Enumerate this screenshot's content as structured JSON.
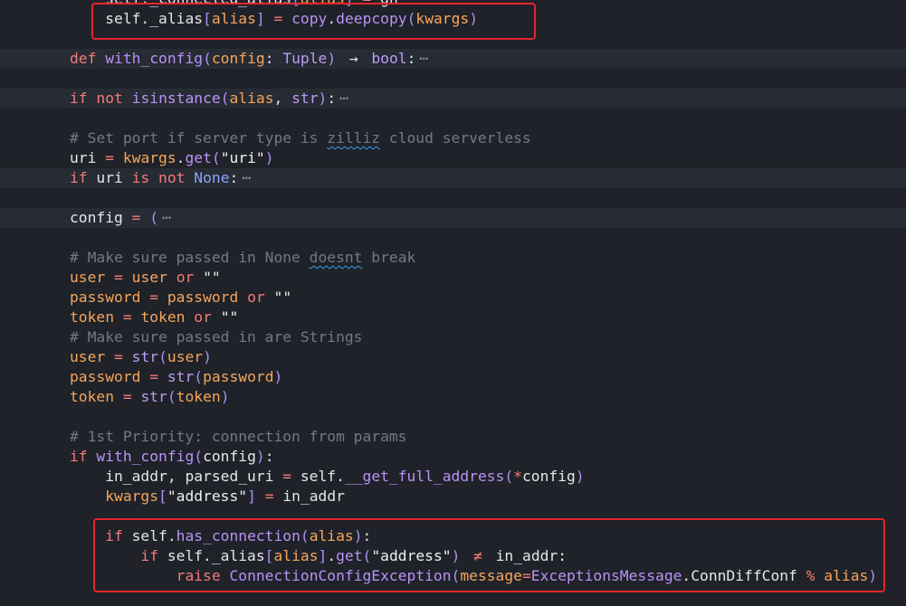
{
  "colors": {
    "background": "#1f2228",
    "fold-band": "#272b33",
    "keyword": "#f47a7a",
    "function": "#b992f8",
    "type": "#bd9cf7",
    "parameter": "#f5a55e",
    "identifier": "#e4e6ea",
    "string": "#eef0f3",
    "constant": "#8ea4ff",
    "bracket": "#ab8ff2",
    "comment": "#737985",
    "fold-marker": "#8c919b",
    "spellcheck": "#3d9df5",
    "annotation": "#e3252b"
  },
  "editor": {
    "lines": [
      {
        "tokens": [
          {
            "t": "    ",
            "k": "ws"
          },
          {
            "t": "self._connected_alias",
            "k": "plain"
          },
          {
            "t": "[",
            "k": "br"
          },
          {
            "t": "alias",
            "k": "param"
          },
          {
            "t": "]",
            "k": "br"
          },
          {
            "t": " ",
            "k": "plain"
          },
          {
            "t": "=",
            "k": "op"
          },
          {
            "t": " gh",
            "k": "plain"
          }
        ]
      },
      {
        "tokens": [
          {
            "t": "    ",
            "k": "ws"
          },
          {
            "t": "self._alias",
            "k": "plain"
          },
          {
            "t": "[",
            "k": "br"
          },
          {
            "t": "alias",
            "k": "param"
          },
          {
            "t": "]",
            "k": "br"
          },
          {
            "t": " ",
            "k": "plain"
          },
          {
            "t": "=",
            "k": "op"
          },
          {
            "t": " ",
            "k": "plain"
          },
          {
            "t": "copy",
            "k": "fn"
          },
          {
            "t": ".",
            "k": "plain"
          },
          {
            "t": "deepcopy",
            "k": "fn"
          },
          {
            "t": "(",
            "k": "br"
          },
          {
            "t": "kwargs",
            "k": "param"
          },
          {
            "t": ")",
            "k": "br"
          }
        ]
      },
      {
        "tokens": []
      },
      {
        "folded": true,
        "tokens": [
          {
            "t": "def",
            "k": "kw"
          },
          {
            "t": " ",
            "k": "plain"
          },
          {
            "t": "with_config",
            "k": "fn"
          },
          {
            "t": "(",
            "k": "br"
          },
          {
            "t": "config",
            "k": "param"
          },
          {
            "t": ": ",
            "k": "plain"
          },
          {
            "t": "Tuple",
            "k": "type"
          },
          {
            "t": ")",
            "k": "br"
          },
          {
            "t": " ",
            "k": "plain"
          },
          {
            "t": "→",
            "k": "plain"
          },
          {
            "t": " ",
            "k": "plain"
          },
          {
            "t": "bool",
            "k": "type"
          },
          {
            "t": ":",
            "k": "plain"
          },
          {
            "t": "⋯",
            "k": "fold"
          }
        ]
      },
      {
        "tokens": []
      },
      {
        "folded": true,
        "tokens": [
          {
            "t": "if",
            "k": "kw"
          },
          {
            "t": " ",
            "k": "plain"
          },
          {
            "t": "not",
            "k": "kw"
          },
          {
            "t": " ",
            "k": "plain"
          },
          {
            "t": "isinstance",
            "k": "fn"
          },
          {
            "t": "(",
            "k": "br"
          },
          {
            "t": "alias",
            "k": "param"
          },
          {
            "t": ", ",
            "k": "plain"
          },
          {
            "t": "str",
            "k": "type"
          },
          {
            "t": ")",
            "k": "br"
          },
          {
            "t": ":",
            "k": "plain"
          },
          {
            "t": "⋯",
            "k": "fold"
          }
        ]
      },
      {
        "tokens": []
      },
      {
        "tokens": [
          {
            "t": "# Set port if server type is ",
            "k": "comment"
          },
          {
            "t": "zilliz",
            "k": "comment",
            "spell": true
          },
          {
            "t": " cloud serverless",
            "k": "comment"
          }
        ]
      },
      {
        "tokens": [
          {
            "t": "uri ",
            "k": "plain"
          },
          {
            "t": "=",
            "k": "op"
          },
          {
            "t": " ",
            "k": "plain"
          },
          {
            "t": "kwargs",
            "k": "param"
          },
          {
            "t": ".",
            "k": "plain"
          },
          {
            "t": "get",
            "k": "fn"
          },
          {
            "t": "(",
            "k": "br"
          },
          {
            "t": "\"uri\"",
            "k": "str"
          },
          {
            "t": ")",
            "k": "br"
          }
        ]
      },
      {
        "folded": true,
        "tokens": [
          {
            "t": "if",
            "k": "kw"
          },
          {
            "t": " uri ",
            "k": "plain"
          },
          {
            "t": "is",
            "k": "kw"
          },
          {
            "t": " ",
            "k": "plain"
          },
          {
            "t": "not",
            "k": "kw"
          },
          {
            "t": " ",
            "k": "plain"
          },
          {
            "t": "None",
            "k": "const"
          },
          {
            "t": ":",
            "k": "plain"
          },
          {
            "t": "⋯",
            "k": "fold"
          }
        ]
      },
      {
        "tokens": []
      },
      {
        "folded": true,
        "tokens": [
          {
            "t": "config ",
            "k": "plain"
          },
          {
            "t": "=",
            "k": "op"
          },
          {
            "t": " ",
            "k": "plain"
          },
          {
            "t": "(",
            "k": "br"
          },
          {
            "t": "⋯",
            "k": "fold"
          }
        ]
      },
      {
        "tokens": []
      },
      {
        "tokens": [
          {
            "t": "# Make sure passed in None ",
            "k": "comment"
          },
          {
            "t": "doesnt",
            "k": "comment",
            "spell": true
          },
          {
            "t": " break",
            "k": "comment"
          }
        ]
      },
      {
        "tokens": [
          {
            "t": "user",
            "k": "param"
          },
          {
            "t": " ",
            "k": "plain"
          },
          {
            "t": "=",
            "k": "op"
          },
          {
            "t": " ",
            "k": "plain"
          },
          {
            "t": "user",
            "k": "param"
          },
          {
            "t": " ",
            "k": "plain"
          },
          {
            "t": "or",
            "k": "kw"
          },
          {
            "t": " ",
            "k": "plain"
          },
          {
            "t": "\"\"",
            "k": "str"
          }
        ]
      },
      {
        "tokens": [
          {
            "t": "password",
            "k": "param"
          },
          {
            "t": " ",
            "k": "plain"
          },
          {
            "t": "=",
            "k": "op"
          },
          {
            "t": " ",
            "k": "plain"
          },
          {
            "t": "password",
            "k": "param"
          },
          {
            "t": " ",
            "k": "plain"
          },
          {
            "t": "or",
            "k": "kw"
          },
          {
            "t": " ",
            "k": "plain"
          },
          {
            "t": "\"\"",
            "k": "str"
          }
        ]
      },
      {
        "tokens": [
          {
            "t": "token",
            "k": "param"
          },
          {
            "t": " ",
            "k": "plain"
          },
          {
            "t": "=",
            "k": "op"
          },
          {
            "t": " ",
            "k": "plain"
          },
          {
            "t": "token",
            "k": "param"
          },
          {
            "t": " ",
            "k": "plain"
          },
          {
            "t": "or",
            "k": "kw"
          },
          {
            "t": " ",
            "k": "plain"
          },
          {
            "t": "\"\"",
            "k": "str"
          }
        ]
      },
      {
        "tokens": [
          {
            "t": "# Make sure passed in are Strings",
            "k": "comment"
          }
        ]
      },
      {
        "tokens": [
          {
            "t": "user",
            "k": "param"
          },
          {
            "t": " ",
            "k": "plain"
          },
          {
            "t": "=",
            "k": "op"
          },
          {
            "t": " ",
            "k": "plain"
          },
          {
            "t": "str",
            "k": "type"
          },
          {
            "t": "(",
            "k": "br"
          },
          {
            "t": "user",
            "k": "param"
          },
          {
            "t": ")",
            "k": "br"
          }
        ]
      },
      {
        "tokens": [
          {
            "t": "password",
            "k": "param"
          },
          {
            "t": " ",
            "k": "plain"
          },
          {
            "t": "=",
            "k": "op"
          },
          {
            "t": " ",
            "k": "plain"
          },
          {
            "t": "str",
            "k": "type"
          },
          {
            "t": "(",
            "k": "br"
          },
          {
            "t": "password",
            "k": "param"
          },
          {
            "t": ")",
            "k": "br"
          }
        ]
      },
      {
        "tokens": [
          {
            "t": "token",
            "k": "param"
          },
          {
            "t": " ",
            "k": "plain"
          },
          {
            "t": "=",
            "k": "op"
          },
          {
            "t": " ",
            "k": "plain"
          },
          {
            "t": "str",
            "k": "type"
          },
          {
            "t": "(",
            "k": "br"
          },
          {
            "t": "token",
            "k": "param"
          },
          {
            "t": ")",
            "k": "br"
          }
        ]
      },
      {
        "tokens": []
      },
      {
        "tokens": [
          {
            "t": "# 1st Priority: connection from params",
            "k": "comment"
          }
        ]
      },
      {
        "tokens": [
          {
            "t": "if",
            "k": "kw"
          },
          {
            "t": " ",
            "k": "plain"
          },
          {
            "t": "with_config",
            "k": "fn"
          },
          {
            "t": "(",
            "k": "br"
          },
          {
            "t": "config",
            "k": "plain"
          },
          {
            "t": ")",
            "k": "br"
          },
          {
            "t": ":",
            "k": "plain"
          }
        ]
      },
      {
        "tokens": [
          {
            "t": "    ",
            "k": "ws"
          },
          {
            "t": "in_addr, parsed_uri ",
            "k": "plain"
          },
          {
            "t": "=",
            "k": "op"
          },
          {
            "t": " self.",
            "k": "plain"
          },
          {
            "t": "__get_full_address",
            "k": "fn"
          },
          {
            "t": "(",
            "k": "br"
          },
          {
            "t": "*",
            "k": "op"
          },
          {
            "t": "config",
            "k": "plain"
          },
          {
            "t": ")",
            "k": "br"
          }
        ]
      },
      {
        "tokens": [
          {
            "t": "    ",
            "k": "ws"
          },
          {
            "t": "kwargs",
            "k": "param"
          },
          {
            "t": "[",
            "k": "br"
          },
          {
            "t": "\"address\"",
            "k": "str"
          },
          {
            "t": "]",
            "k": "br"
          },
          {
            "t": " ",
            "k": "plain"
          },
          {
            "t": "=",
            "k": "op"
          },
          {
            "t": " in_addr",
            "k": "plain"
          }
        ]
      },
      {
        "tokens": []
      },
      {
        "tokens": [
          {
            "t": "    ",
            "k": "ws"
          },
          {
            "t": "if",
            "k": "kw"
          },
          {
            "t": " self.",
            "k": "plain"
          },
          {
            "t": "has_connection",
            "k": "fn"
          },
          {
            "t": "(",
            "k": "br"
          },
          {
            "t": "alias",
            "k": "param"
          },
          {
            "t": ")",
            "k": "br"
          },
          {
            "t": ":",
            "k": "plain"
          }
        ]
      },
      {
        "tokens": [
          {
            "t": "        ",
            "k": "ws"
          },
          {
            "t": "if",
            "k": "kw"
          },
          {
            "t": " self._alias",
            "k": "plain"
          },
          {
            "t": "[",
            "k": "br"
          },
          {
            "t": "alias",
            "k": "param"
          },
          {
            "t": "]",
            "k": "br"
          },
          {
            "t": ".",
            "k": "plain"
          },
          {
            "t": "get",
            "k": "fn"
          },
          {
            "t": "(",
            "k": "br"
          },
          {
            "t": "\"address\"",
            "k": "str"
          },
          {
            "t": ")",
            "k": "br"
          },
          {
            "t": " ",
            "k": "plain"
          },
          {
            "t": "≠",
            "k": "op"
          },
          {
            "t": " in_addr:",
            "k": "plain"
          }
        ]
      },
      {
        "tokens": [
          {
            "t": "            ",
            "k": "ws"
          },
          {
            "t": "raise",
            "k": "kw"
          },
          {
            "t": " ",
            "k": "plain"
          },
          {
            "t": "ConnectionConfigException",
            "k": "fn"
          },
          {
            "t": "(",
            "k": "br"
          },
          {
            "t": "message",
            "k": "param"
          },
          {
            "t": "=",
            "k": "op"
          },
          {
            "t": "ExceptionsMessage",
            "k": "fn"
          },
          {
            "t": ".ConnDiffConf ",
            "k": "plain"
          },
          {
            "t": "%",
            "k": "op"
          },
          {
            "t": " ",
            "k": "plain"
          },
          {
            "t": "alias",
            "k": "param"
          },
          {
            "t": ")",
            "k": "br"
          }
        ]
      }
    ]
  }
}
